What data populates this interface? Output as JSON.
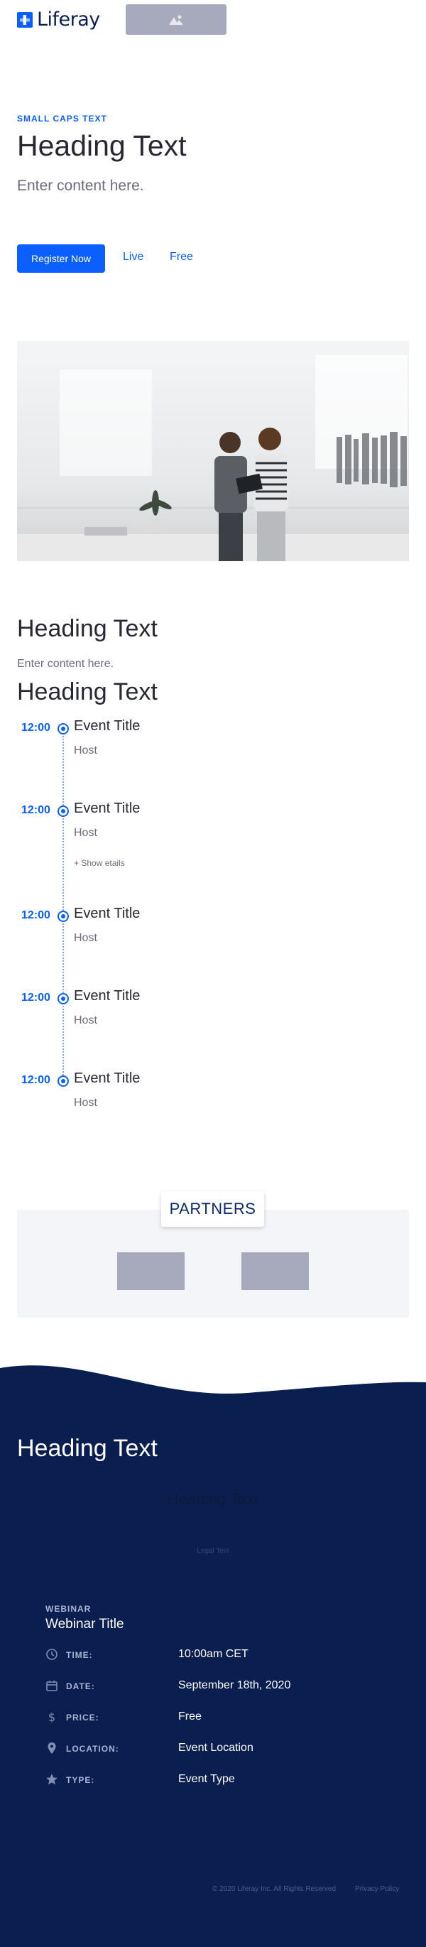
{
  "header": {
    "logo_text": "Liferay",
    "brand_color": "#0b5fff",
    "image_placeholder_icon": "image-icon"
  },
  "hero": {
    "kicker": "SMALL CAPS TEXT",
    "title": "Heading Text",
    "lead": "Enter content here.",
    "register_label": "Register Now",
    "live_label": "Live",
    "free_label": "Free"
  },
  "agenda": {
    "title": "Heading Text",
    "subtitle": "Enter content here.",
    "schedule_title": "Heading Text",
    "events": [
      {
        "time": "12:00",
        "title": "Event Title",
        "host": "Host",
        "more": ""
      },
      {
        "time": "12:00",
        "title": "Event Title",
        "host": "Host",
        "more": "+ Show etails"
      },
      {
        "time": "12:00",
        "title": "Event Title",
        "host": "Host",
        "more": ""
      },
      {
        "time": "12:00",
        "title": "Event Title",
        "host": "Host",
        "more": ""
      },
      {
        "time": "12:00",
        "title": "Event Title",
        "host": "Host",
        "more": ""
      }
    ]
  },
  "partners": {
    "label": "PARTNERS"
  },
  "footer": {
    "background_color": "#0a1e4f",
    "title": "Heading Text",
    "hidden_title": "Heading Text",
    "legal": "Legal Text",
    "webinar_kicker": "WEBINAR",
    "webinar_title": "Webinar Title",
    "rows": [
      {
        "icon": "clock-icon",
        "label": "TIME:",
        "value": "10:00am CET"
      },
      {
        "icon": "calendar-icon",
        "label": "DATE:",
        "value": "September 18th, 2020"
      },
      {
        "icon": "dollar-icon",
        "label": "PRICE:",
        "value": "Free"
      },
      {
        "icon": "location-pin-icon",
        "label": "LOCATION:",
        "value": "Event Location"
      },
      {
        "icon": "star-icon",
        "label": "TYPE:",
        "value": "Event Type"
      }
    ],
    "copyright": "© 2020 Liferay Inc. All Rights Reserved",
    "privacy": "Privacy Policy"
  }
}
